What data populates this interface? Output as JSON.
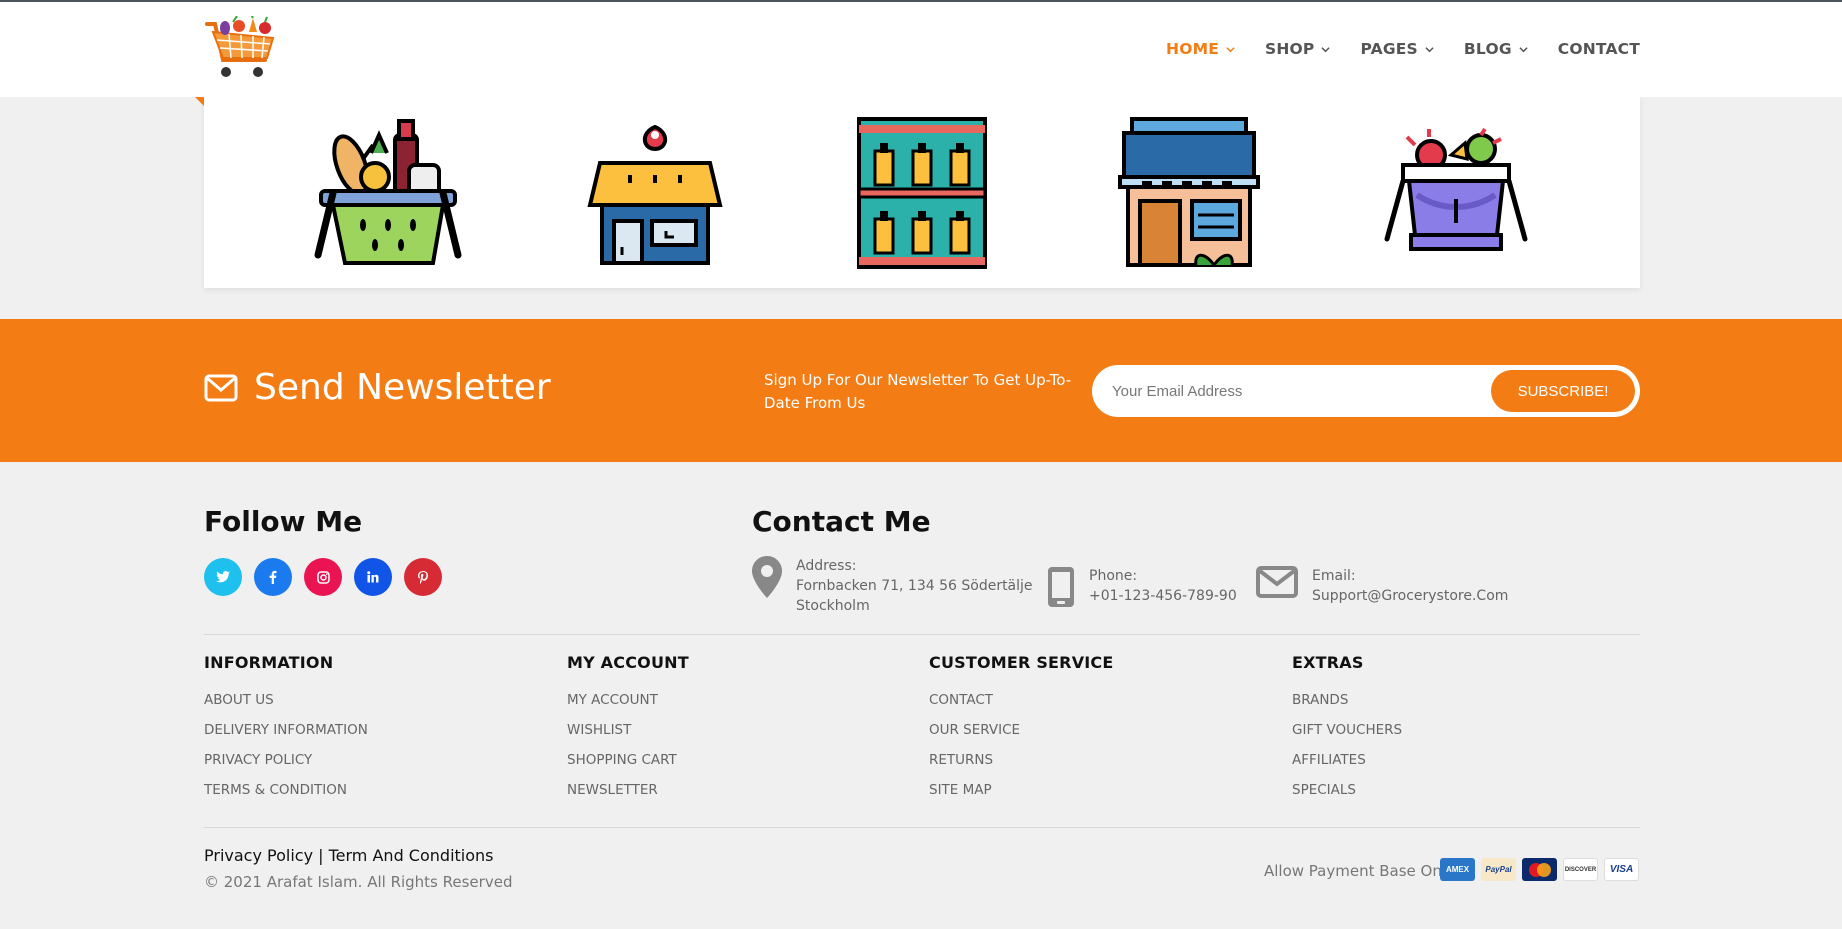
{
  "header": {
    "nav": [
      {
        "label": "HOME",
        "active": true,
        "has_dropdown": true
      },
      {
        "label": "SHOP",
        "active": false,
        "has_dropdown": true
      },
      {
        "label": "PAGES",
        "active": false,
        "has_dropdown": true
      },
      {
        "label": "BLOG",
        "active": false,
        "has_dropdown": true
      },
      {
        "label": "CONTACT",
        "active": false,
        "has_dropdown": false
      }
    ]
  },
  "categories": [
    {
      "icon": "grocery-basket-icon"
    },
    {
      "icon": "store-location-icon"
    },
    {
      "icon": "shelf-icon"
    },
    {
      "icon": "shop-front-icon"
    },
    {
      "icon": "fruit-basket-icon"
    }
  ],
  "newsletter": {
    "title": "Send Newsletter",
    "text": "Sign Up For Our Newsletter To Get Up-To-Date From Us",
    "placeholder": "Your Email Address",
    "button": "SUBSCRIBE!"
  },
  "follow": {
    "title": "Follow Me",
    "socials": [
      {
        "name": "twitter",
        "glyph": "t",
        "color": "#1ec0ee"
      },
      {
        "name": "facebook",
        "glyph": "f",
        "color": "#1b7bee"
      },
      {
        "name": "instagram",
        "glyph": "◎",
        "color": "#ea1452"
      },
      {
        "name": "linkedin",
        "glyph": "in",
        "color": "#1054e8"
      },
      {
        "name": "pinterest",
        "glyph": "p",
        "color": "#d62b35"
      }
    ]
  },
  "contact": {
    "title": "Contact Me",
    "address_label": "Address:",
    "address_line1": "Fornbacken 71, 134 56 Södertälje",
    "address_line2": "Stockholm",
    "phone_label": "Phone:",
    "phone": "+01-123-456-789-90",
    "email_label": "Email:",
    "email": "Support@Grocerystore.Com"
  },
  "columns": [
    {
      "title": "INFORMATION",
      "links": [
        "ABOUT US",
        "DELIVERY INFORMATION",
        "PRIVACY POLICY",
        "TERMS & CONDITION"
      ]
    },
    {
      "title": "MY ACCOUNT",
      "links": [
        "MY ACCOUNT",
        "WISHLIST",
        "SHOPPING CART",
        "NEWSLETTER"
      ]
    },
    {
      "title": "CUSTOMER SERVICE",
      "links": [
        "CONTACT",
        "OUR SERVICE",
        "RETURNS",
        "SITE MAP"
      ]
    },
    {
      "title": "EXTRAS",
      "links": [
        "BRANDS",
        "GIFT VOUCHERS",
        "AFFILIATES",
        "SPECIALS"
      ]
    }
  ],
  "footer": {
    "privacy": "Privacy Policy",
    "separator": " | ",
    "terms": "Term And Conditions",
    "copyright": "© 2021 Arafat Islam. All Rights Reserved",
    "payment_label": "Allow Payment Base On",
    "cards": [
      {
        "name": "american-express",
        "label": "AMEX"
      },
      {
        "name": "paypal",
        "label": "PayPal"
      },
      {
        "name": "mastercard",
        "label": "MC"
      },
      {
        "name": "discover",
        "label": "DISCOVER"
      },
      {
        "name": "visa",
        "label": "VISA"
      }
    ]
  },
  "colors": {
    "accent": "#f47c14",
    "background": "#f0f0f0"
  }
}
